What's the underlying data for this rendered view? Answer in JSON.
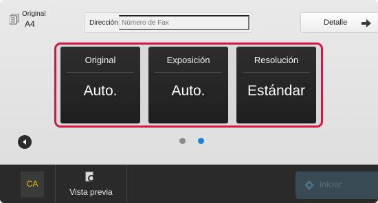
{
  "header": {
    "original_label": "Original",
    "original_size": "A4",
    "address_label": "Dirección",
    "fax_placeholder": "Número de Fax",
    "detail_label": "Detalle"
  },
  "panels": [
    {
      "title": "Original",
      "value": "Auto."
    },
    {
      "title": "Exposición",
      "value": "Auto."
    },
    {
      "title": "Resolución",
      "value": "Estándar"
    }
  ],
  "pagination": {
    "page_count": 2,
    "current_page": 2
  },
  "bottom_bar": {
    "ca_label": "CA",
    "preview_label": "Vista previa",
    "start_label": "Iniciar"
  },
  "colors": {
    "highlight": "#d6163f",
    "active_dot": "#1d7fe0",
    "ca_text": "#f2c200"
  },
  "icons": {
    "original": "document-stack-icon",
    "detail": "arrow-right-icon",
    "back": "chevron-left-icon",
    "preview": "magnifier-document-icon",
    "start": "diamond-start-icon"
  }
}
